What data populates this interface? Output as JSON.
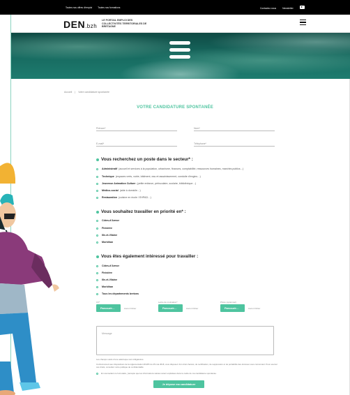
{
  "topbar": {
    "link1": "Toutes nos offres d'emploi",
    "link2": "Toutes nos formations",
    "contact": "Contactez-nous",
    "newsletter": "Newsletter"
  },
  "header": {
    "logo": "DEN",
    "logo_suffix": ".bzh",
    "tagline": "LE PORTAIL EMPLOI DES COLLECTIVITÉS TERRITORIALES DE BRETAGNE"
  },
  "breadcrumb": {
    "home": "Accueil",
    "current": "Votre candidature spontanée"
  },
  "page_title": "VOTRE CANDIDATURE SPONTANÉE",
  "fields": {
    "prenom": "Prénom*",
    "nom": "Nom*",
    "email": "E-mail*",
    "telephone": "Téléphone*"
  },
  "sector": {
    "title": "Vous recherchez un poste dans le secteur* :",
    "options": [
      {
        "name": "Administratif",
        "desc": "(accueil et services à la population, urbanisme, finances, comptabilité, ressources humaines, marchés publics…)"
      },
      {
        "name": "Technique",
        "desc": "(espaces verts, voirie, bâtiment, eau et assainissement, conduite d'engins…)"
      },
      {
        "name": "Jeunesse Animation Culture",
        "desc": "(petite enfance, périscolaire, scolaire, bibliothèque…)"
      },
      {
        "name": "Médico-social",
        "desc": "(aide à domicile…)"
      },
      {
        "name": "Restauration",
        "desc": "(cuisine en école / EHPAD…)"
      }
    ]
  },
  "priority": {
    "title": "Vous souhaitez travailler en priorité en* :",
    "options": [
      "Côtes-d'Armor",
      "Finistère",
      "Ille-et-Vilaine",
      "Morbihan"
    ]
  },
  "also": {
    "title": "Vous êtes également intéressé pour travailler :",
    "options": [
      "Côtes-d'Armor",
      "Finistère",
      "Ille-et-Vilaine",
      "Morbihan",
      "Tous les départements bretons"
    ]
  },
  "files": [
    {
      "label": "CV*",
      "button": "Parcourir…",
      "status": "Aucun fichier"
    },
    {
      "label": "Lettre de motivation*",
      "button": "Parcourir…",
      "status": "Aucun fichier"
    },
    {
      "label": "Photo (optionnel)",
      "button": "Parcourir…",
      "status": "Aucun fichier"
    }
  ],
  "message_placeholder": "Message",
  "required_note": "Les champs suivis d'une astérisque sont obligatoires.",
  "info_text": "Conformément aux dispositions de la réglementation RGPD du 25 mai 2018, vous disposez d'un droit d'accès, de rectification, de suppression et de portabilité des données vous concernant. Pour exercer ces droits, consultez notre politique de confidentialité.",
  "consent_text": "En soumettant ce formulaire, j'accepte que les informations saisies soient exploitées dans le cadre de ma candidature spontanée.",
  "submit_label": "Je dépose ma candidature",
  "colors": {
    "accent": "#4ec49f",
    "topbar": "#000000"
  }
}
